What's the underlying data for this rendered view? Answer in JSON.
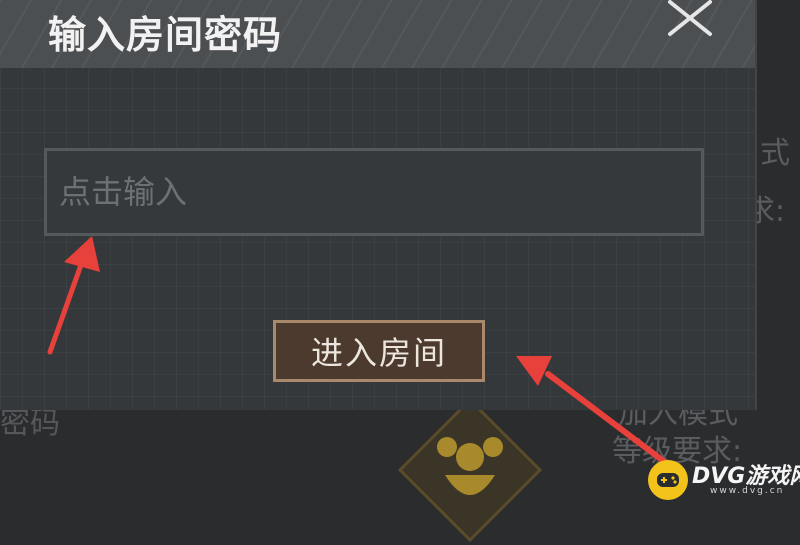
{
  "dialog": {
    "title": "输入房间密码",
    "close_icon": "close-icon",
    "input": {
      "value": "",
      "placeholder": "点击输入"
    },
    "enter_button_label": "进入房间"
  },
  "background": {
    "right_line_1": "式",
    "right_line_2": "求:",
    "left_bottom": "密码",
    "bottom_right_1": "加入模式",
    "bottom_right_2": "等级要求:"
  },
  "watermark": {
    "brand": "DVG游戏网",
    "domain": "www.dvg.cn",
    "icon": "gamepad-icon"
  },
  "colors": {
    "dialog_bg": "#35383b",
    "header_bg": "#4c4f52",
    "button_bg": "#4b3a2d",
    "button_border": "#a9896c",
    "arrow": "#e8403a",
    "watermark_icon": "#f3c31b"
  }
}
